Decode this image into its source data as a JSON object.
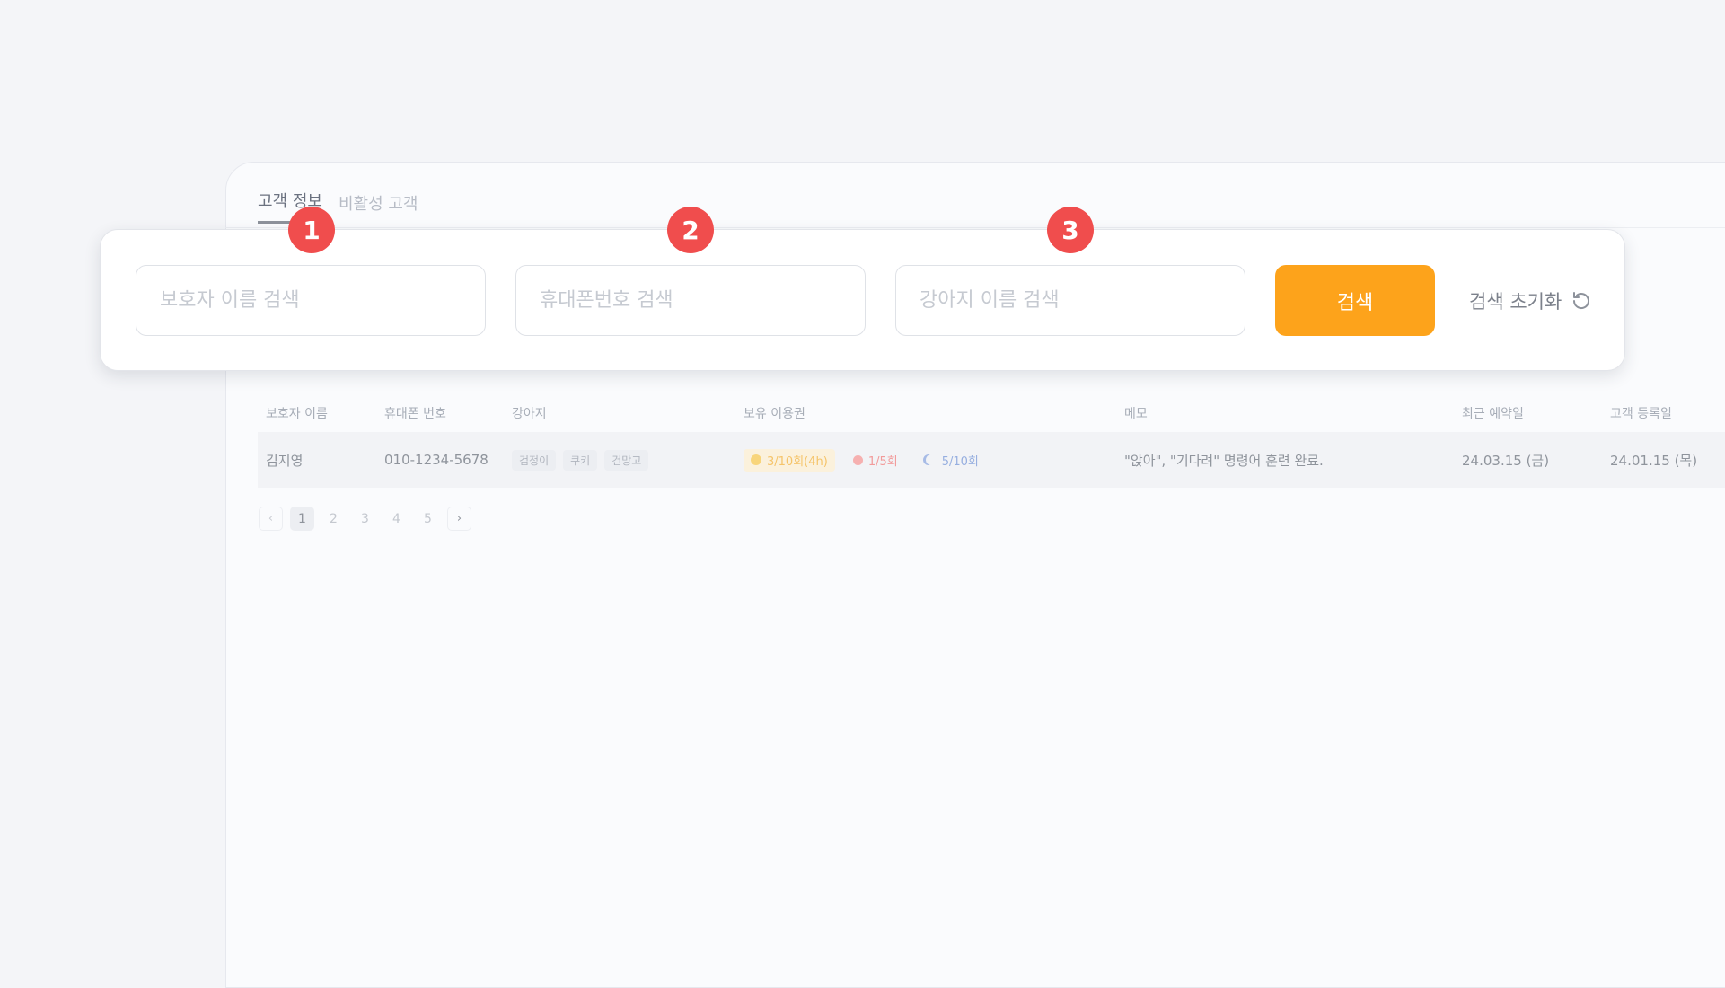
{
  "tabs": [
    {
      "label": "고객 정보",
      "active": true
    },
    {
      "label": "비활성 고객",
      "active": false
    }
  ],
  "search": {
    "guardian_placeholder": "보호자 이름 검색",
    "phone_placeholder": "휴대폰번호 검색",
    "dog_placeholder": "강아지 이름 검색",
    "search_label": "검색",
    "reset_label": "검색 초기화",
    "button_color": "#fda31b"
  },
  "badges": [
    "1",
    "2",
    "3"
  ],
  "badge_color": "#f04d4d",
  "table": {
    "headers": [
      "보호자 이름",
      "휴대폰 번호",
      "강아지",
      "보유 이용권",
      "메모",
      "최근 예약일",
      "고객 등록일"
    ],
    "rows": [
      {
        "guardian": "김지영",
        "phone": "010-1234-5678",
        "dogs": [
          "검정이",
          "쿠키",
          "건망고"
        ],
        "passes": [
          {
            "icon": "sun-icon",
            "text": "3/10회(4h)"
          },
          {
            "icon": "day-icon",
            "text": "1/5회"
          },
          {
            "icon": "moon-icon",
            "text": "5/10회"
          }
        ],
        "memo": "\"앉아\", \"기다려\" 명령어 훈련 완료.",
        "last_reservation": "24.03.15 (금)",
        "registered": "24.01.15 (목)"
      }
    ]
  },
  "pagination": {
    "prev": "‹",
    "pages": [
      "1",
      "2",
      "3",
      "4",
      "5"
    ],
    "next": "›",
    "current": "1"
  }
}
